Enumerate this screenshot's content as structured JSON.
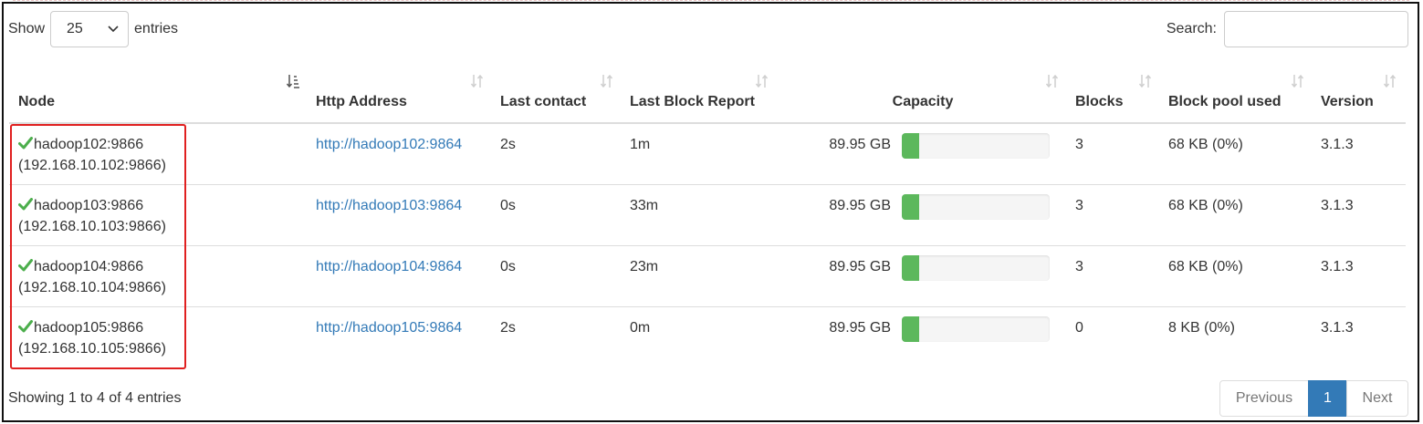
{
  "length": {
    "show_label": "Show",
    "value": "25",
    "entries_label": "entries"
  },
  "search": {
    "label": "Search:",
    "value": "",
    "placeholder": ""
  },
  "columns": [
    {
      "label": "Node",
      "sort": "sorted-asc"
    },
    {
      "label": "Http Address",
      "sort": "both"
    },
    {
      "label": "Last contact",
      "sort": "both"
    },
    {
      "label": "Last Block Report",
      "sort": "both"
    },
    {
      "label": "Capacity",
      "sort": "both"
    },
    {
      "label": "Blocks",
      "sort": "both"
    },
    {
      "label": "Block pool used",
      "sort": "both"
    },
    {
      "label": "Version",
      "sort": "both"
    }
  ],
  "rows": [
    {
      "status_icon": "check-icon",
      "node": "hadoop102:9866",
      "node_ip": "(192.168.10.102:9866)",
      "http": "http://hadoop102:9864",
      "last_contact": "2s",
      "last_block_report": "1m",
      "capacity": "89.95 GB",
      "capacity_used": 0.12,
      "blocks": "3",
      "block_pool_used": "68 KB (0%)",
      "version": "3.1.3"
    },
    {
      "status_icon": "check-icon",
      "node": "hadoop103:9866",
      "node_ip": "(192.168.10.103:9866)",
      "http": "http://hadoop103:9864",
      "last_contact": "0s",
      "last_block_report": "33m",
      "capacity": "89.95 GB",
      "capacity_used": 0.12,
      "blocks": "3",
      "block_pool_used": "68 KB (0%)",
      "version": "3.1.3"
    },
    {
      "status_icon": "check-icon",
      "node": "hadoop104:9866",
      "node_ip": "(192.168.10.104:9866)",
      "http": "http://hadoop104:9864",
      "last_contact": "0s",
      "last_block_report": "23m",
      "capacity": "89.95 GB",
      "capacity_used": 0.12,
      "blocks": "3",
      "block_pool_used": "68 KB (0%)",
      "version": "3.1.3"
    },
    {
      "status_icon": "check-icon",
      "node": "hadoop105:9866",
      "node_ip": "(192.168.10.105:9866)",
      "http": "http://hadoop105:9864",
      "last_contact": "2s",
      "last_block_report": "0m",
      "capacity": "89.95 GB",
      "capacity_used": 0.12,
      "blocks": "0",
      "block_pool_used": "8 KB (0%)",
      "version": "3.1.3"
    }
  ],
  "footer": {
    "info": "Showing 1 to 4 of 4 entries"
  },
  "pagination": {
    "previous": "Previous",
    "current": "1",
    "next": "Next"
  },
  "colors": {
    "link": "#337ab7",
    "bar_fill": "#5cb85c",
    "bar_bg": "#f5f5f5",
    "check": "#4cae4c",
    "highlight_box": "#e02020",
    "active_page": "#337ab7"
  }
}
